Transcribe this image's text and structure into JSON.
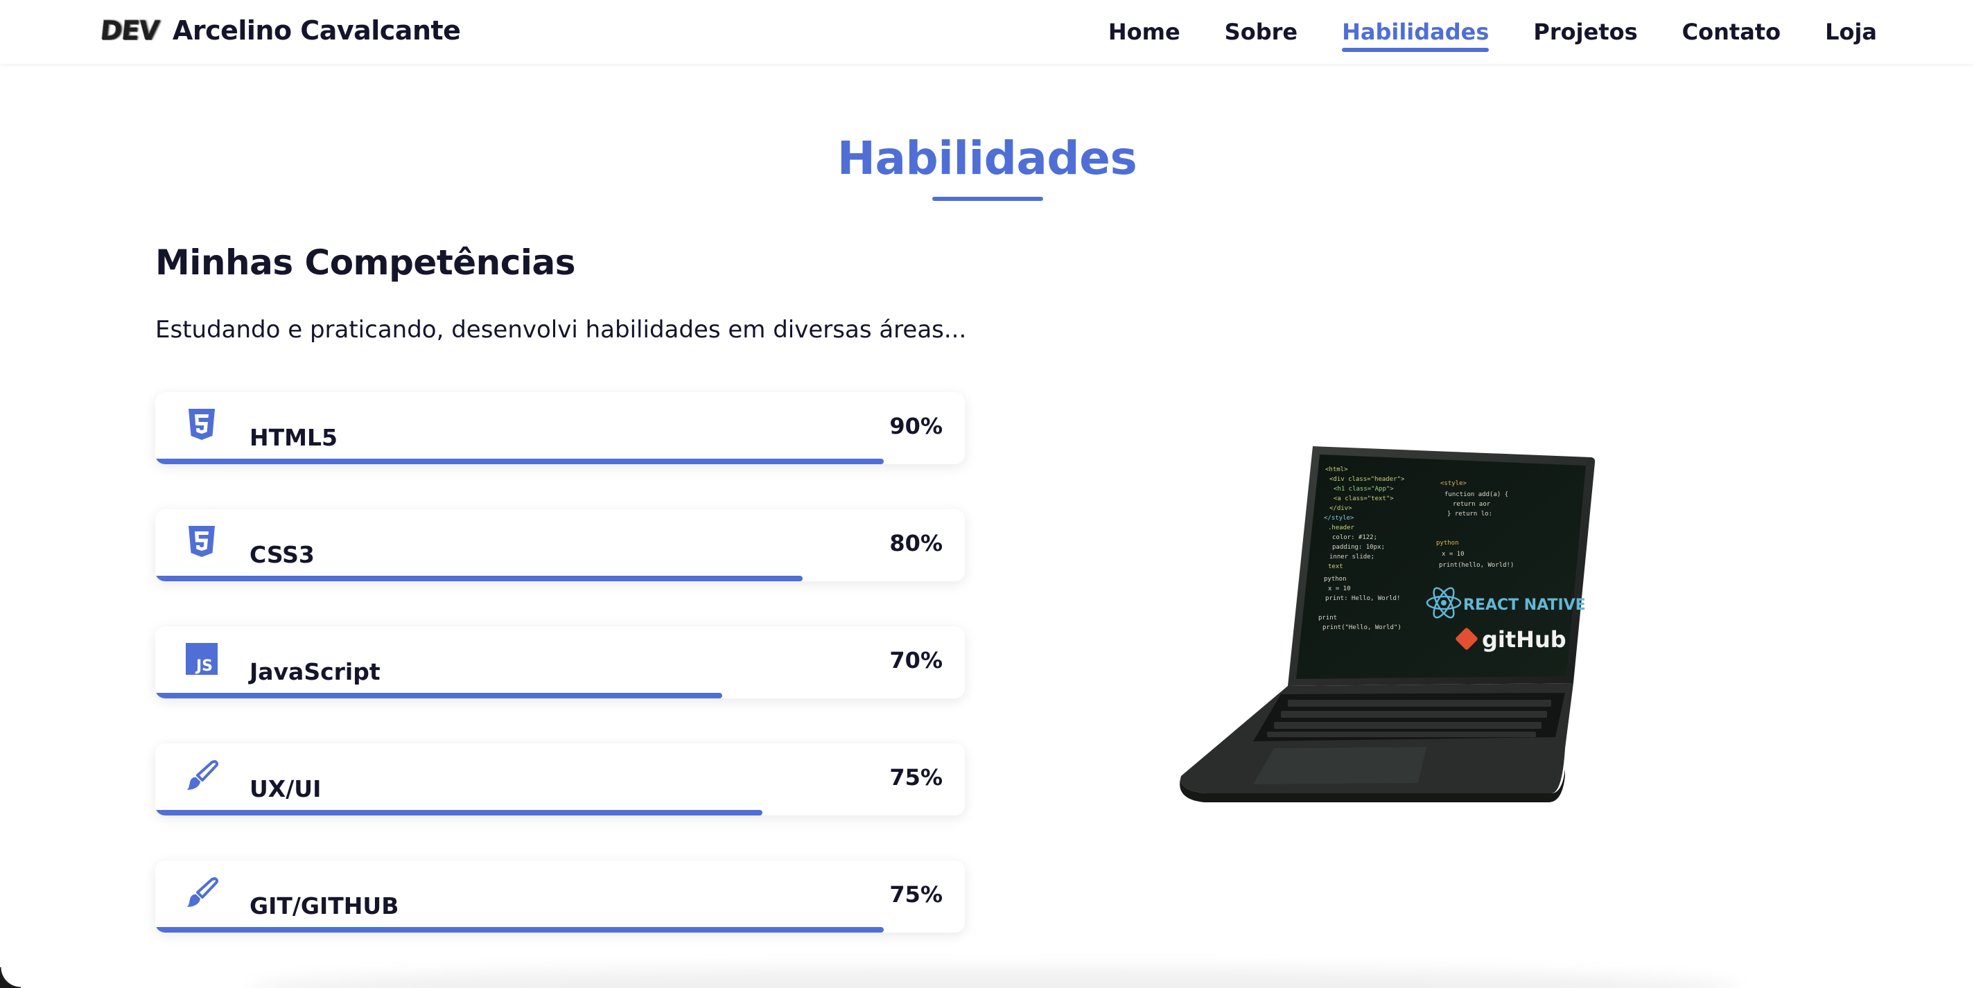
{
  "header": {
    "logo_text": "DEV",
    "brand_name": "Arcelino Cavalcante",
    "nav": [
      {
        "label": "Home",
        "active": false
      },
      {
        "label": "Sobre",
        "active": false
      },
      {
        "label": "Habilidades",
        "active": true
      },
      {
        "label": "Projetos",
        "active": false
      },
      {
        "label": "Contato",
        "active": false
      },
      {
        "label": "Loja",
        "active": false
      }
    ]
  },
  "section": {
    "title": "Habilidades",
    "subtitle": "Minhas Competências",
    "description": "Estudando e praticando, desenvolvi habilidades em diversas áreas..."
  },
  "skills": [
    {
      "name": "HTML5",
      "percent_label": "90%",
      "level": 0.9,
      "icon": "html5-icon"
    },
    {
      "name": "CSS3",
      "percent_label": "80%",
      "level": 0.8,
      "icon": "css3-icon"
    },
    {
      "name": "JavaScript",
      "percent_label": "70%",
      "level": 0.7,
      "icon": "javascript-icon"
    },
    {
      "name": "UX/UI",
      "percent_label": "75%",
      "level": 0.75,
      "icon": "brush-icon"
    },
    {
      "name": "GIT/GITHUB",
      "percent_label": "75%",
      "level": 0.9,
      "icon": "brush-icon"
    }
  ],
  "illustration": {
    "badges": [
      "REACT NATIVE",
      "gitHub"
    ]
  },
  "colors": {
    "accent": "#4f6fd6",
    "text": "#14142b",
    "laptop_body": "#2a2d2b",
    "screen": "#0d1411",
    "react": "#61b8d6",
    "git": "#e24f33"
  }
}
